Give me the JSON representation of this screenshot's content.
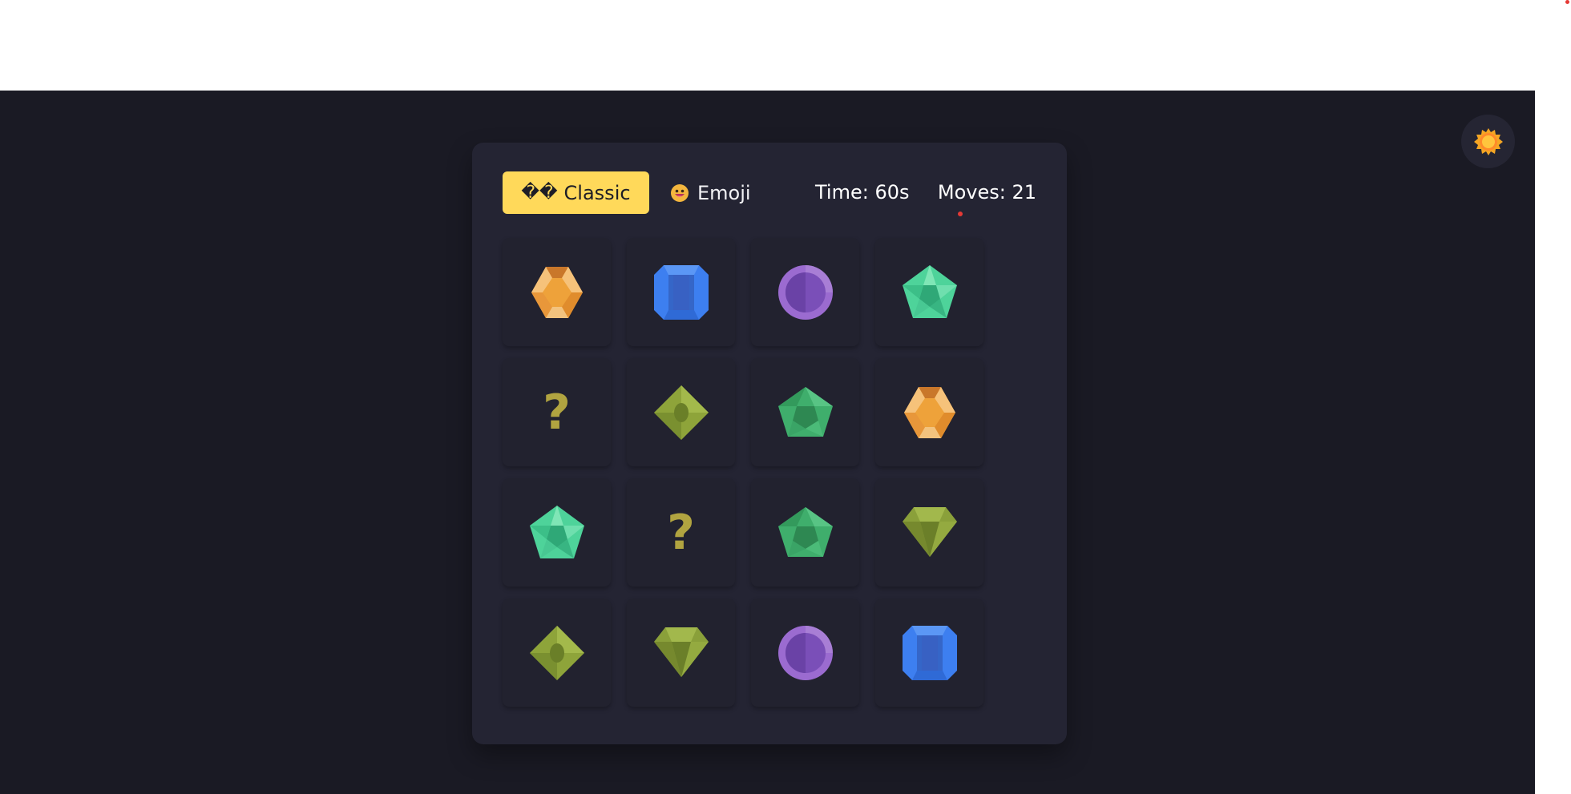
{
  "modes": {
    "classic_prefix": "��",
    "classic_label": "Classic",
    "emoji_label": "Emoji",
    "selected": "classic"
  },
  "stats": {
    "time": "Time: 60s",
    "moves": "Moves: 21"
  },
  "theme_toggle": {
    "icon": "sun-icon"
  },
  "board": {
    "rows": 4,
    "cols": 4,
    "hidden_symbol": "?",
    "cards": [
      {
        "state": "revealed",
        "gem": "hexagon-orange"
      },
      {
        "state": "revealed",
        "gem": "octagon-blue"
      },
      {
        "state": "revealed",
        "gem": "circle-purple"
      },
      {
        "state": "revealed",
        "gem": "pentagon-teal"
      },
      {
        "state": "hidden",
        "gem": ""
      },
      {
        "state": "revealed",
        "gem": "rhombus-olive"
      },
      {
        "state": "revealed",
        "gem": "pentagon-green"
      },
      {
        "state": "revealed",
        "gem": "hexagon-orange"
      },
      {
        "state": "revealed",
        "gem": "pentagon-teal"
      },
      {
        "state": "hidden",
        "gem": ""
      },
      {
        "state": "revealed",
        "gem": "pentagon-green"
      },
      {
        "state": "revealed",
        "gem": "diamond-olive"
      },
      {
        "state": "revealed",
        "gem": "rhombus-olive"
      },
      {
        "state": "revealed",
        "gem": "diamond-olive"
      },
      {
        "state": "revealed",
        "gem": "circle-purple"
      },
      {
        "state": "revealed",
        "gem": "octagon-blue"
      }
    ]
  },
  "colors": {
    "stage_bg": "#1a1a24",
    "panel_bg": "#242433",
    "card_bg": "#22222f",
    "accent": "#ffd95a",
    "hidden_mark": "#b1a440"
  }
}
